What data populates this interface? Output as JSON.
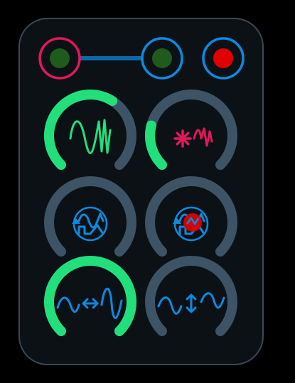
{
  "colors": {
    "background": "#000000",
    "panel": "#0c1116",
    "panel_border": "#3a4854",
    "track": "#3d5466",
    "active": "#21e07b",
    "blue": "#0a8be0",
    "pink": "#e0195a",
    "led_green": "#1f5b1c",
    "led_red": "#e00000",
    "link": "#0a6aa8"
  },
  "indicators": [
    {
      "name": "indicator-left",
      "ring": "pink",
      "led": "led_green",
      "on": true
    },
    {
      "name": "indicator-middle",
      "ring": "blue",
      "led": "led_green",
      "on": true
    },
    {
      "name": "indicator-right",
      "ring": "blue",
      "led": "led_red",
      "on": true
    }
  ],
  "link_between": [
    "indicator-left",
    "indicator-middle"
  ],
  "knobs": [
    {
      "id": "knob-wave-pitch",
      "icon": "wave-pitch-icon",
      "active": true,
      "level": 0.62,
      "icon_color": "active",
      "badge": false
    },
    {
      "id": "knob-random-wave",
      "icon": "random-wave-icon",
      "active": true,
      "level": 0.22,
      "icon_color": "pink",
      "badge": false
    },
    {
      "id": "knob-waveform-cycle-1",
      "icon": "waveform-cycle-icon",
      "active": false,
      "level": 0,
      "icon_color": "blue",
      "badge": false
    },
    {
      "id": "knob-waveform-cycle-2",
      "icon": "waveform-cycle-icon",
      "active": false,
      "level": 0,
      "icon_color": "blue",
      "badge": true
    },
    {
      "id": "knob-wave-stretch-horizontal",
      "icon": "wave-stretch-horizontal-icon",
      "active": true,
      "level": 1.0,
      "icon_color": "blue",
      "badge": false
    },
    {
      "id": "knob-wave-stretch-vertical",
      "icon": "wave-stretch-vertical-icon",
      "active": false,
      "level": 0,
      "icon_color": "blue",
      "badge": false
    }
  ]
}
